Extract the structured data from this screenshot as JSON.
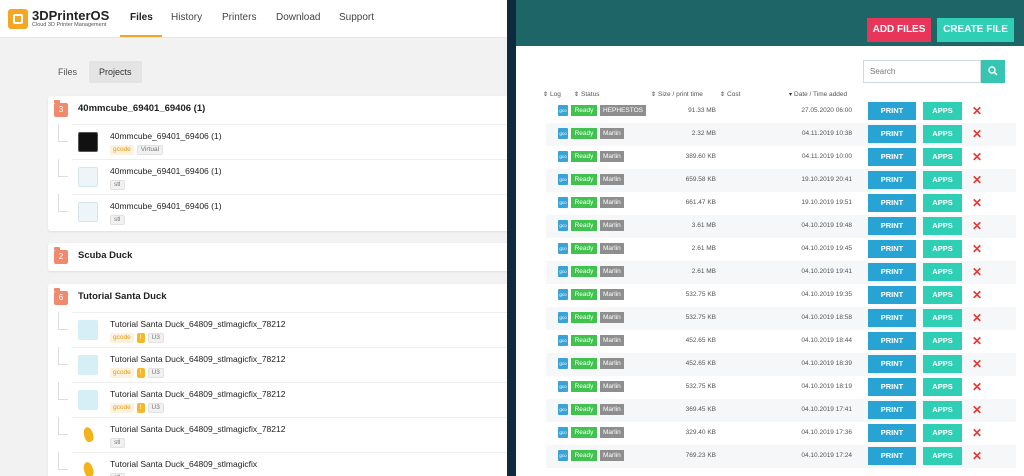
{
  "left": {
    "brand": "3DPrinterOS",
    "tagline": "Cloud 3D Printer Management",
    "nav": [
      "Files",
      "History",
      "Printers",
      "Download",
      "Support"
    ],
    "subtabs": [
      "Files",
      "Projects"
    ],
    "projects": [
      {
        "count": "3",
        "title": "40mmcube_69401_69406 (1)",
        "files": [
          {
            "name": "40mmcube_69401_69406 (1)",
            "thumb": "black",
            "tags": [
              {
                "t": "gcode",
                "c": "gcode"
              },
              {
                "t": "Virtual",
                "c": "grey"
              }
            ],
            "price": "$4"
          },
          {
            "name": "40mmcube_69401_69406 (1)",
            "thumb": "ghost",
            "tags": [
              {
                "t": "stl",
                "c": "grey"
              }
            ],
            "price": ""
          },
          {
            "name": "40mmcube_69401_69406 (1)",
            "thumb": "ghost",
            "tags": [
              {
                "t": "stl",
                "c": "grey"
              }
            ],
            "price": ""
          }
        ]
      },
      {
        "count": "2",
        "title": "Scuba Duck",
        "files": []
      },
      {
        "count": "6",
        "title": "Tutorial Santa Duck",
        "files": [
          {
            "name": "Tutorial Santa Duck_64809_stlmagicfix_78212",
            "thumb": "cyan",
            "tags": [
              {
                "t": "gcode",
                "c": "gcode"
              },
              {
                "t": "!",
                "c": "warn"
              },
              {
                "t": "U3",
                "c": "grey"
              }
            ],
            "price": "$3"
          },
          {
            "name": "Tutorial Santa Duck_64809_stlmagicfix_78212",
            "thumb": "cyan",
            "tags": [
              {
                "t": "gcode",
                "c": "gcode"
              },
              {
                "t": "!",
                "c": "warn"
              },
              {
                "t": "U3",
                "c": "grey"
              }
            ],
            "price": "$0"
          },
          {
            "name": "Tutorial Santa Duck_64809_stlmagicfix_78212",
            "thumb": "cyan",
            "tags": [
              {
                "t": "gcode",
                "c": "gcode"
              },
              {
                "t": "!",
                "c": "warn"
              },
              {
                "t": "U3",
                "c": "grey"
              }
            ],
            "price": "$0"
          },
          {
            "name": "Tutorial Santa Duck_64809_stlmagicfix_78212",
            "thumb": "duck",
            "tags": [
              {
                "t": "stl",
                "c": "grey"
              }
            ],
            "price": ""
          },
          {
            "name": "Tutorial Santa Duck_64809_stlmagicfix",
            "thumb": "duck",
            "tags": [
              {
                "t": "stl",
                "c": "grey"
              }
            ],
            "price": ""
          }
        ]
      }
    ]
  },
  "right": {
    "add_files": "ADD FILES",
    "create_file": "CREATE FILE",
    "search_placeholder": "Search",
    "columns": {
      "log": "Log",
      "status": "Status",
      "size": "Size / print time",
      "cost": "Cost",
      "date": "Date / Time added"
    },
    "gco": "gco",
    "ready": "Ready",
    "print": "PRINT",
    "apps": "APPS",
    "rows": [
      {
        "printer": "HEPHESTOS",
        "size": "91.33 MB",
        "date": "27.05.2020 06:00"
      },
      {
        "printer": "Marlin",
        "size": "2.32 MB",
        "date": "04.11.2019 10:38"
      },
      {
        "printer": "Marlin",
        "size": "389.60 KB",
        "date": "04.11.2019 10:00"
      },
      {
        "printer": "Marlin",
        "size": "659.58 KB",
        "date": "19.10.2019 20:41"
      },
      {
        "printer": "Marlin",
        "size": "661.47 KB",
        "date": "19.10.2019 19:51"
      },
      {
        "printer": "Marlin",
        "size": "3.61 MB",
        "date": "04.10.2019 19:48"
      },
      {
        "printer": "Marlin",
        "size": "2.61 MB",
        "date": "04.10.2019 19:45"
      },
      {
        "printer": "Marlin",
        "size": "2.61 MB",
        "date": "04.10.2019 19:41"
      },
      {
        "printer": "Marlin",
        "size": "532.75 KB",
        "date": "04.10.2019 19:35"
      },
      {
        "printer": "Marlin",
        "size": "532.75 KB",
        "date": "04.10.2019 18:58"
      },
      {
        "printer": "Marlin",
        "size": "452.65 KB",
        "date": "04.10.2019 18:44"
      },
      {
        "printer": "Marlin",
        "size": "452.65 KB",
        "date": "04.10.2019 18:39"
      },
      {
        "printer": "Marlin",
        "size": "532.75 KB",
        "date": "04.10.2019 18:19"
      },
      {
        "printer": "Marlin",
        "size": "369.45 KB",
        "date": "04.10.2019 17:41"
      },
      {
        "printer": "Marlin",
        "size": "329.40 KB",
        "date": "04.10.2019 17:36"
      },
      {
        "printer": "Marlin",
        "size": "769.23 KB",
        "date": "04.10.2019 17:24"
      }
    ]
  }
}
